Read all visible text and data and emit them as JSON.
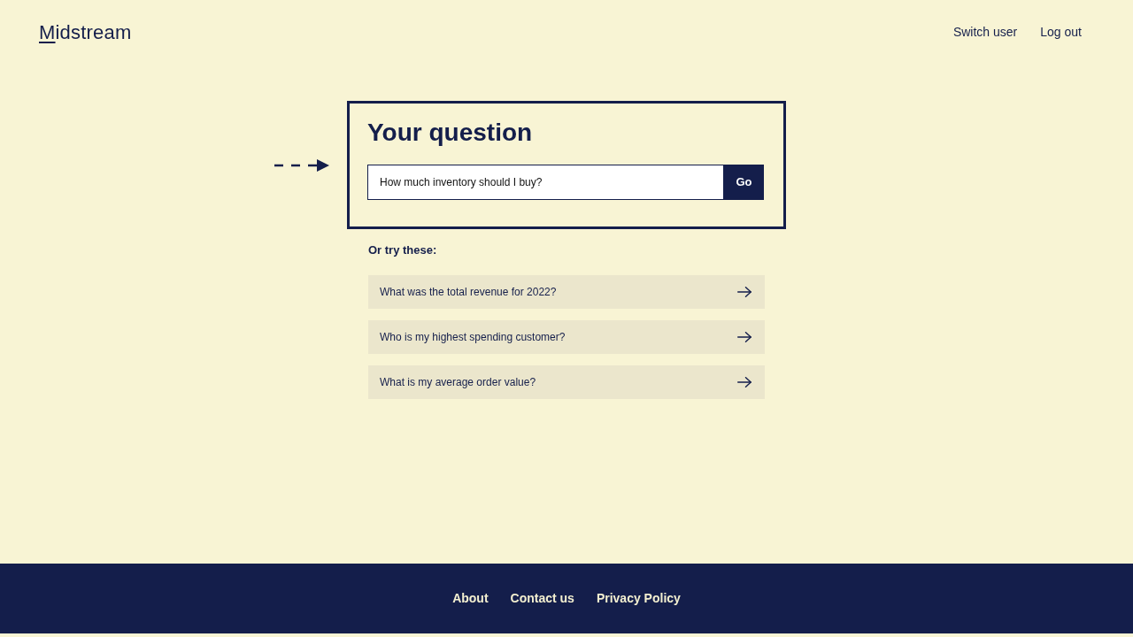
{
  "header": {
    "logo": "Midstream",
    "nav_links": [
      "Switch user",
      "Log out"
    ]
  },
  "question_card": {
    "title": "Your question",
    "input": {
      "value": "How much inventory should I buy?"
    },
    "submit_button": "Go"
  },
  "suggestions": {
    "heading": "Or try these:",
    "items": [
      "What was the total revenue for 2022?",
      "Who is my highest spending customer?",
      "What is my average order value?"
    ]
  },
  "footer": {
    "links": [
      "About",
      "Contact us",
      "Privacy Policy"
    ]
  }
}
